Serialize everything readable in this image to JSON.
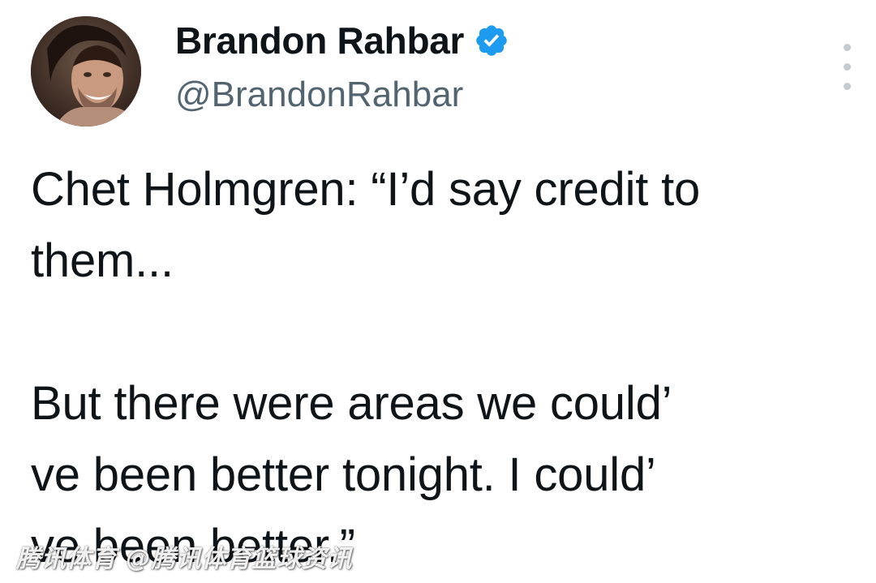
{
  "tweet": {
    "author": {
      "display_name": "Brandon Rahbar",
      "handle": "@BrandonRahbar",
      "verified_icon": "verified-badge-icon",
      "avatar_icon": "avatar-photo",
      "brand_color": "#1d9bf0"
    },
    "more_icon": "more-vertical-icon",
    "text": "Chet Holmgren: “I’d say credit to\nthem...\n\nBut there were areas we could’\nve been better tonight. I could’\nve been better.”"
  },
  "watermark": {
    "text": "腾讯体育 @腾讯体育篮球资讯"
  }
}
